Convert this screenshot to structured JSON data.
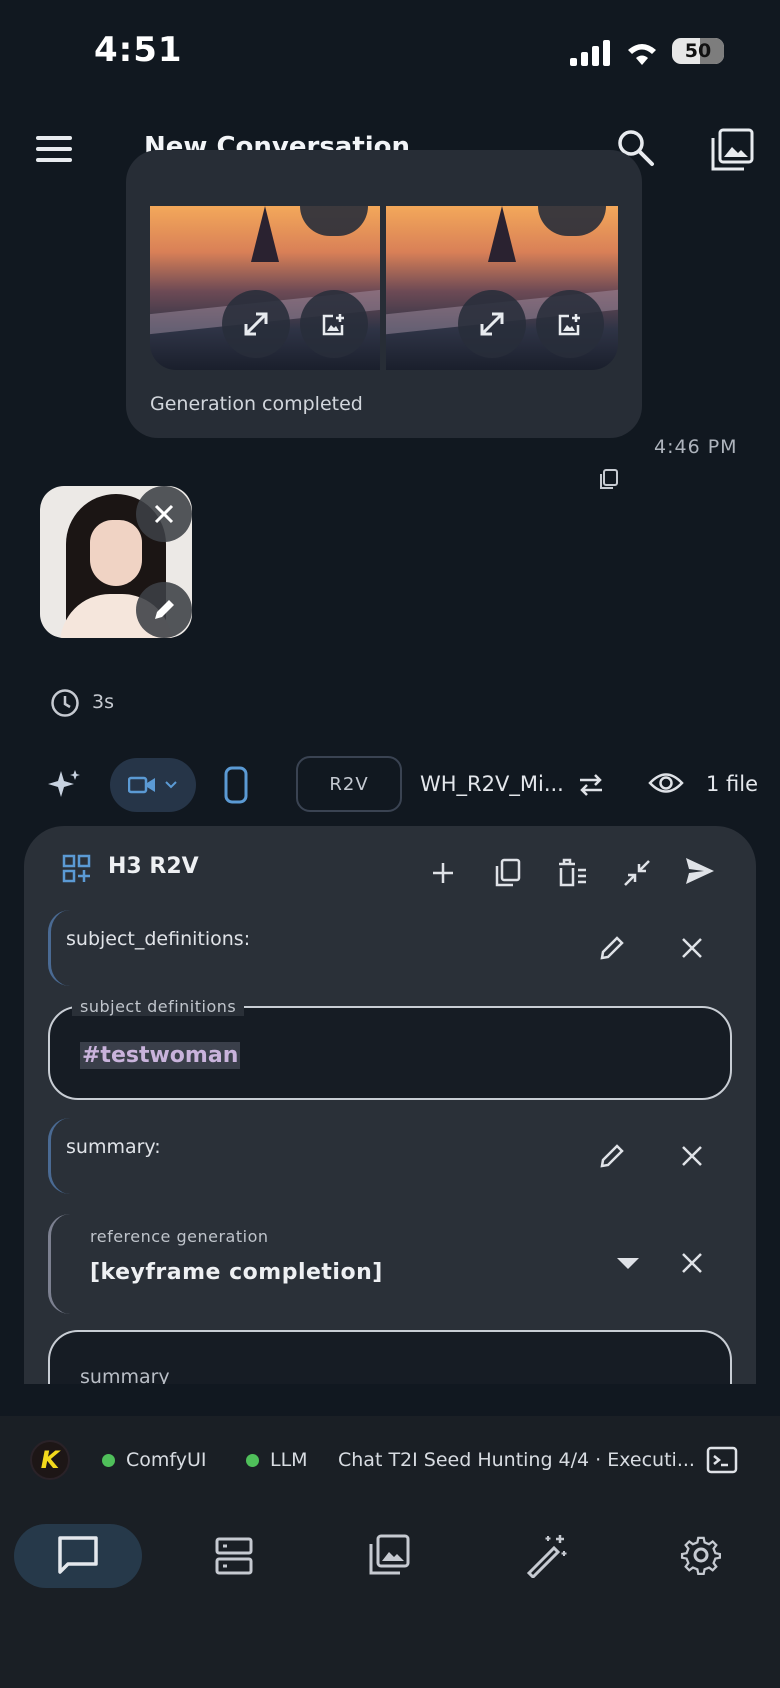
{
  "status_bar": {
    "time": "4:51",
    "battery": "50"
  },
  "app_bar": {
    "title": "New Conversation"
  },
  "message": {
    "status": "Generation completed",
    "time": "4:46 PM"
  },
  "attachment": {
    "duration": "3s"
  },
  "toolbar": {
    "mode_chip": "R2V",
    "workflow": "WH_R2V_Mi...",
    "files": "1 file"
  },
  "panel": {
    "title": "H3 R2V",
    "params": [
      {
        "label": "subject_definitions:",
        "field_label": "subject definitions",
        "value": "#testwoman"
      },
      {
        "label": "summary:"
      }
    ],
    "reference": {
      "label": "reference generation",
      "value": "[keyframe completion]"
    },
    "summary_field": "summary"
  },
  "status_strip": {
    "items": [
      {
        "label": "ComfyUI",
        "color": "#4fbf5a"
      },
      {
        "label": "LLM",
        "color": "#4fbf5a"
      }
    ],
    "task": "Chat T2I Seed Hunting 4/4 · Executi..."
  },
  "colors": {
    "accent": "#5b9ad4",
    "background": "#111820",
    "panel": "#2a3038"
  }
}
